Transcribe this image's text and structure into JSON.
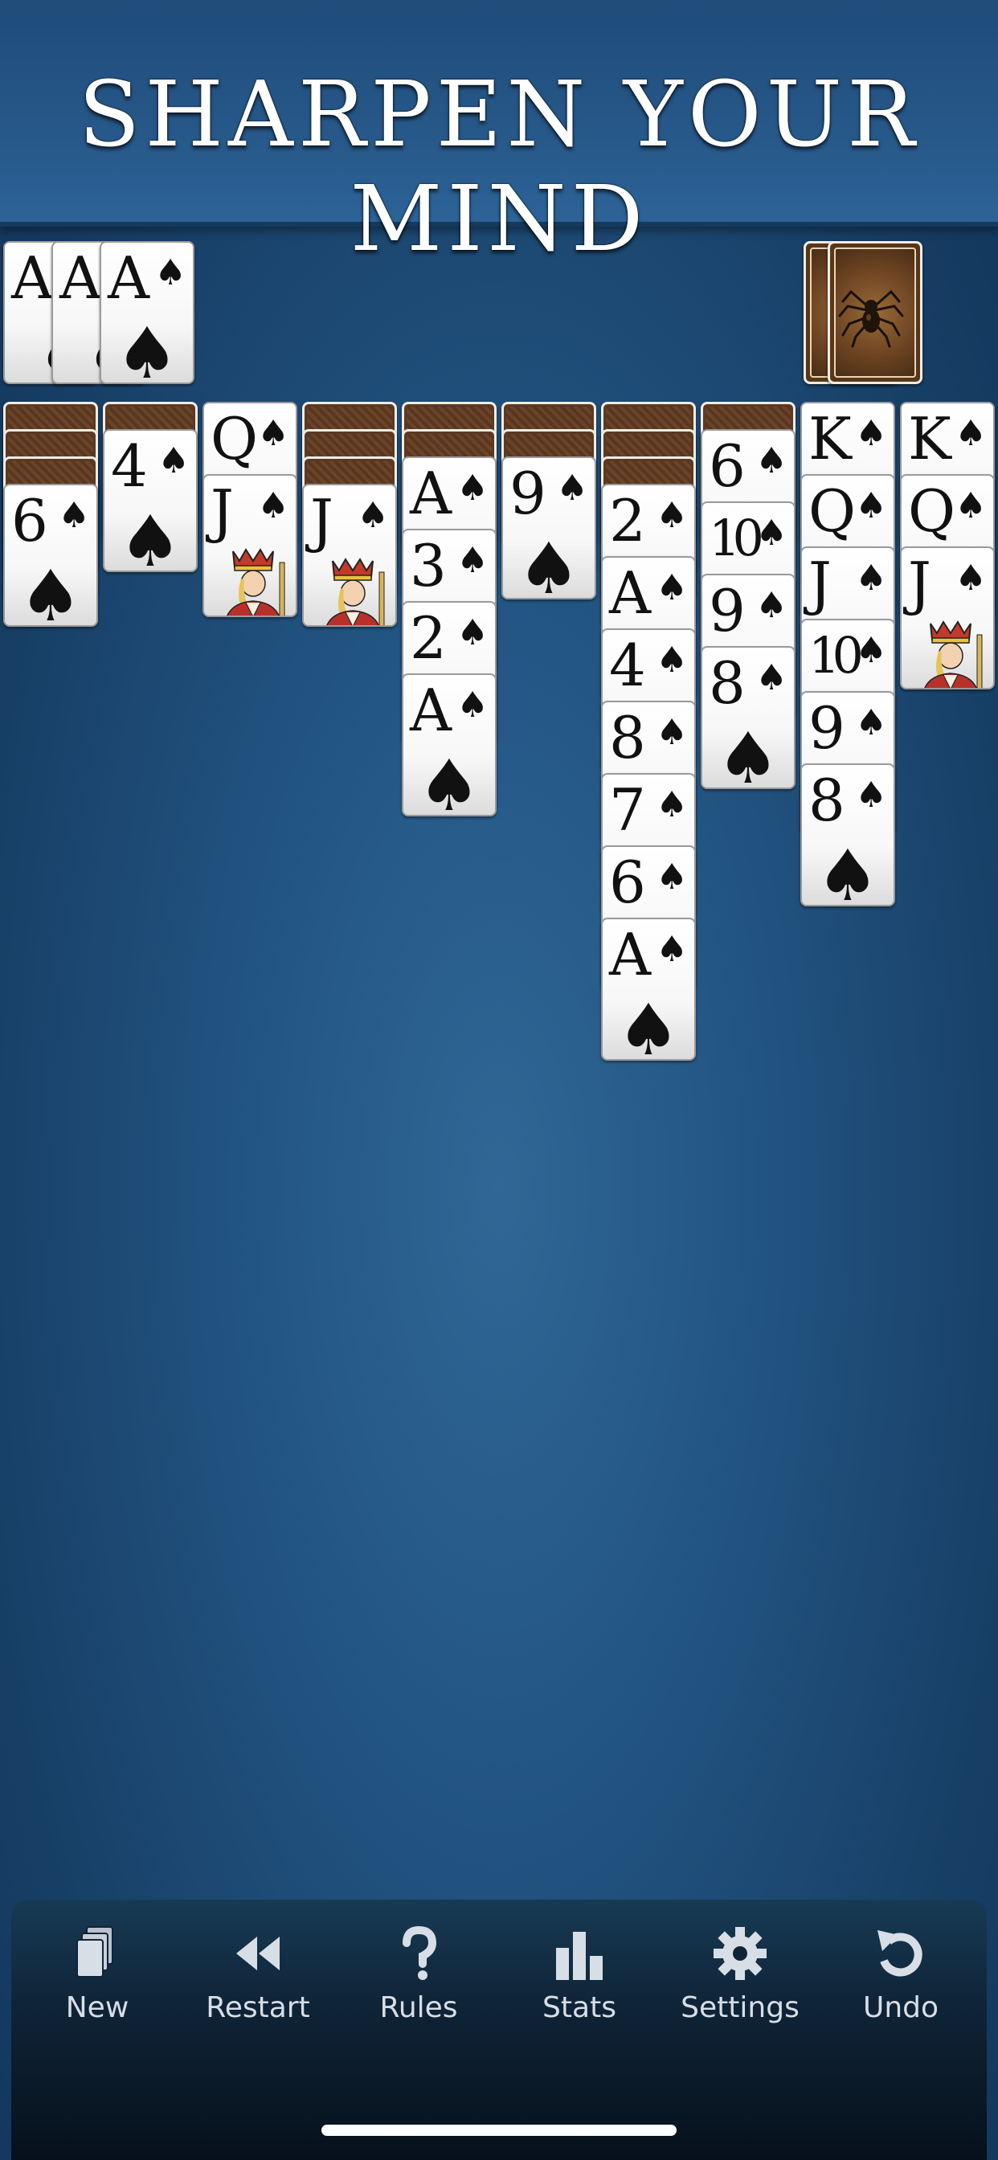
{
  "banner": {
    "title": "SHARPEN YOUR MIND"
  },
  "foundation": [
    {
      "rank": "A",
      "suit": "♠"
    },
    {
      "rank": "A",
      "suit": "♠"
    },
    {
      "rank": "A",
      "suit": "♠"
    }
  ],
  "stock": {
    "icon": "spider-icon",
    "piles": 1
  },
  "tableau": [
    {
      "down": 3,
      "up": [
        {
          "rank": "6",
          "suit": "♠"
        }
      ]
    },
    {
      "down": 1,
      "up": [
        {
          "rank": "4",
          "suit": "♠"
        }
      ]
    },
    {
      "down": 0,
      "up": [
        {
          "rank": "Q",
          "suit": "♠"
        },
        {
          "rank": "J",
          "suit": "♠"
        }
      ]
    },
    {
      "down": 3,
      "up": [
        {
          "rank": "J",
          "suit": "♠"
        }
      ]
    },
    {
      "down": 2,
      "up": [
        {
          "rank": "A",
          "suit": "♠"
        },
        {
          "rank": "3",
          "suit": "♠"
        },
        {
          "rank": "2",
          "suit": "♠"
        },
        {
          "rank": "A",
          "suit": "♠"
        }
      ]
    },
    {
      "down": 2,
      "up": [
        {
          "rank": "9",
          "suit": "♠"
        }
      ]
    },
    {
      "down": 3,
      "up": [
        {
          "rank": "2",
          "suit": "♠"
        },
        {
          "rank": "A",
          "suit": "♠"
        },
        {
          "rank": "4",
          "suit": "♠"
        },
        {
          "rank": "8",
          "suit": "♠"
        },
        {
          "rank": "7",
          "suit": "♠"
        },
        {
          "rank": "6",
          "suit": "♠"
        },
        {
          "rank": "A",
          "suit": "♠"
        }
      ]
    },
    {
      "down": 1,
      "up": [
        {
          "rank": "6",
          "suit": "♠"
        },
        {
          "rank": "10",
          "suit": "♠"
        },
        {
          "rank": "9",
          "suit": "♠"
        },
        {
          "rank": "8",
          "suit": "♠"
        }
      ]
    },
    {
      "down": 0,
      "up": [
        {
          "rank": "K",
          "suit": "♠"
        },
        {
          "rank": "Q",
          "suit": "♠"
        },
        {
          "rank": "J",
          "suit": "♠"
        },
        {
          "rank": "10",
          "suit": "♠"
        },
        {
          "rank": "9",
          "suit": "♠"
        },
        {
          "rank": "8",
          "suit": "♠"
        }
      ]
    },
    {
      "down": 0,
      "up": [
        {
          "rank": "K",
          "suit": "♠"
        },
        {
          "rank": "Q",
          "suit": "♠"
        },
        {
          "rank": "J",
          "suit": "♠"
        }
      ]
    }
  ],
  "toolbar": {
    "items": [
      {
        "label": "New",
        "icon": "new-cards-icon"
      },
      {
        "label": "Restart",
        "icon": "rewind-icon"
      },
      {
        "label": "Rules",
        "icon": "question-icon"
      },
      {
        "label": "Stats",
        "icon": "bar-chart-icon"
      },
      {
        "label": "Settings",
        "icon": "gear-icon"
      },
      {
        "label": "Undo",
        "icon": "undo-icon"
      }
    ]
  },
  "colors": {
    "background": "#235583",
    "banner": "#285a8c",
    "toolbar": "#0f2438",
    "card_back": "#5a3a22"
  }
}
